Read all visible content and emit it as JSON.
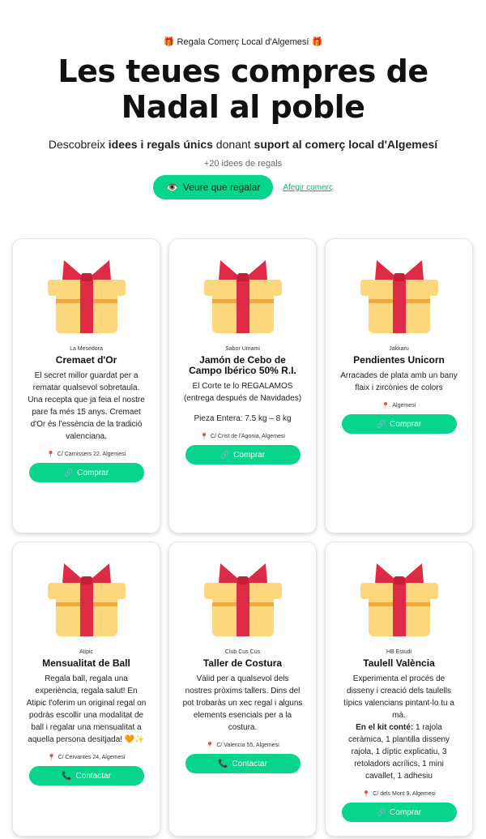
{
  "hero": {
    "eyebrow": "🎁 Regala Comerç Local d'Algemesí 🎁",
    "title_line1": "Les teues compres de",
    "title_line2": "Nadal al poble",
    "subtitle_pre": "Descobreix ",
    "subtitle_b1": "idees i regals únics",
    "subtitle_mid": " donant ",
    "subtitle_b2": "suport al comerç local d'Algemesí",
    "count": "+20 idees de regals",
    "cta_label": "Veure que regalar",
    "add_link": "Afegir comerç"
  },
  "cards": [
    {
      "vendor": "La Mesedora",
      "name": "Cremaet d'Or",
      "desc": [
        "El secret millor guardat per a rematar qualsevol sobretaula. Una recepta que ja feia el nostre pare fa més 15 anys. Cremaet d'Or és l'essència de la tradició valenciana."
      ],
      "address": "C/ Carnissers 22, Algemesi",
      "button": "Comprar"
    },
    {
      "vendor": "Sabor Umami",
      "name": "Jamón de Cebo de Campo Ibérico 50% R.I.",
      "desc": [
        "El Corte te lo REGALAMOS (entrega después de Navidades)",
        "Pieza Entera: 7.5 kg – 8 kg"
      ],
      "address": "C/ Crist de l'Agonia, Algemesi",
      "button": "Comprar"
    },
    {
      "vendor": "Jakkaru",
      "name": "Pendientes Unicorn",
      "desc": [
        "Arracades de plata amb un bany flaix i zircònies de colors"
      ],
      "address": "Algemesí",
      "button": "Comprar"
    },
    {
      "vendor": "Atipic",
      "name": "Mensualitat de Ball",
      "desc": [
        "Regala ball, regala una experiència, regala salut! En Atipic t'oferim un original regal on podràs escollir una modalitat de ball i regalar una mensualitat a aquella persona desitjada! 🧡✨"
      ],
      "address": "C/ Cervantes 24, Algemesi",
      "button": "Contactar"
    },
    {
      "vendor": "Club Cus Cus",
      "name": "Taller de Costura",
      "desc": [
        "Vàlid per a qualsevol dels nostres pròxims tallers. Dins del pot trobaràs un xec regal i alguns elements esencials per a la costura."
      ],
      "address": "C/ Valencia 55, Algemesi",
      "button": "Contactar"
    },
    {
      "vendor": "HB Estudi",
      "name": "Taulell València",
      "desc": [
        "Experimenta el procés de disseny i creació dels taulells típics valencians pintant-lo tu a mà."
      ],
      "kit_label": "En el kit conté:",
      "kit_text": " 1 rajola ceràmica, 1 plantilla disseny rajola, 1 díptic explicatiu, 3 retoladors acrílics, 1 mini cavallet, 1 adhesiu",
      "address": "C/ dels Mont 9, Algemesi",
      "button": "Comprar"
    }
  ],
  "colors": {
    "accent": "#06d58b",
    "gift_box": "#fdd77d",
    "gift_ribbon": "#de2b45",
    "gift_band": "#f7a63a"
  }
}
